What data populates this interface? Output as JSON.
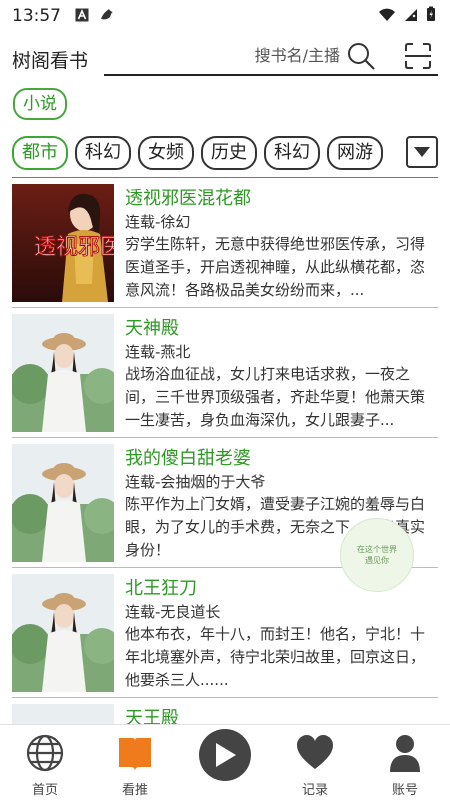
{
  "status_bar": {
    "time": "13:57"
  },
  "header": {
    "app_title": "树阁看书",
    "search_placeholder": "搜书名/主播"
  },
  "category": {
    "label": "小说"
  },
  "tags": [
    "都市",
    "科幻",
    "女频",
    "历史",
    "科幻",
    "网游"
  ],
  "books": [
    {
      "title": "透视邪医混花都",
      "meta": "连载-徐幻",
      "description": "穷学生陈轩，无意中获得绝世邪医传承，习得医道圣手，开启透视神瞳，从此纵横花都，恣意风流！各路极品美女纷纷而来，...",
      "cover_text": "透视邪医"
    },
    {
      "title": "天神殿",
      "meta": "连载-燕北",
      "description": "战场浴血征战，女儿打来电话求救，一夜之间，三千世界顶级强者，齐赴华夏！他萧天策一生凄苦，身负血海深仇，女儿跟妻子..."
    },
    {
      "title": "我的傻白甜老婆",
      "meta": "连载-会抽烟的于大爷",
      "description": "陈平作为上门女婿，遭受妻子江婉的羞辱与白眼，为了女儿的手术费，无奈之下，亮出真实身份！"
    },
    {
      "title": "北王狂刀",
      "meta": "连载-无良道长",
      "description": "他本布衣，年十八，而封王！他名，宁北！十年北境塞外声，待宁北荣归故里，回京这日，他要杀三人......"
    },
    {
      "title": "天王殿",
      "meta": "",
      "description": ""
    }
  ],
  "float_badge": {
    "line1": "在这个世界",
    "line2": "遇见你"
  },
  "nav": [
    {
      "label": "首页",
      "icon": "globe-icon"
    },
    {
      "label": "看推",
      "icon": "book-icon"
    },
    {
      "label": "",
      "icon": "play-icon"
    },
    {
      "label": "记录",
      "icon": "heart-icon"
    },
    {
      "label": "账号",
      "icon": "user-icon"
    }
  ],
  "colors": {
    "accent": "#2e9a25",
    "nav_active": "#f07b1d"
  }
}
